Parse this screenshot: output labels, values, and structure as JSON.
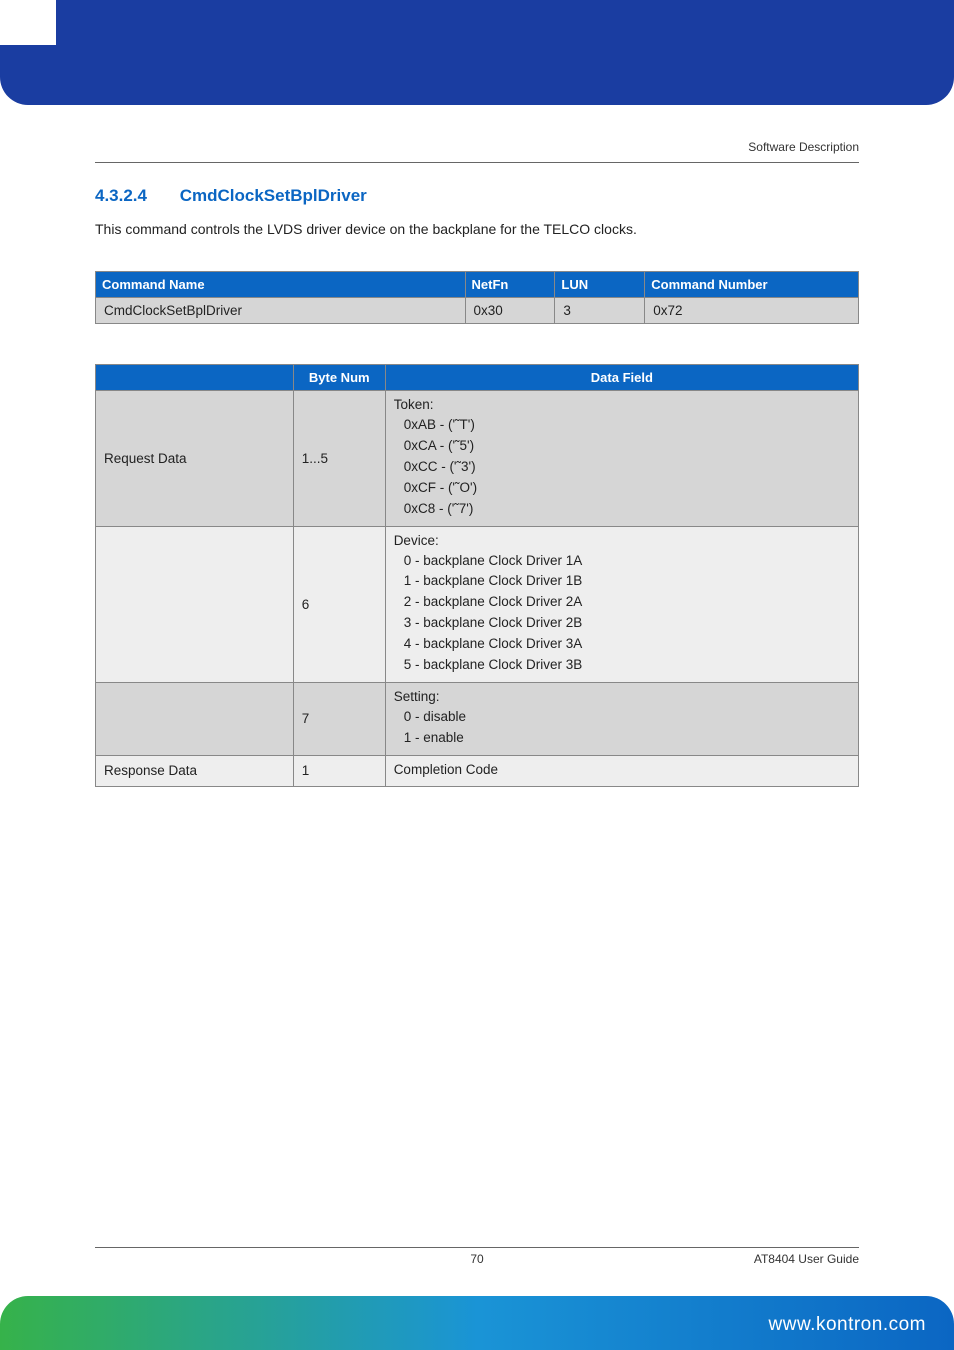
{
  "header": {
    "chapter": "Software Description"
  },
  "section": {
    "number": "4.3.2.4",
    "title": "CmdClockSetBplDriver"
  },
  "paragraph": "This command controls the LVDS driver device on the backplane for the TELCO clocks.",
  "table1": {
    "headers": {
      "name": "Command Name",
      "netfn": "NetFn",
      "lun": "LUN",
      "cmd": "Command Number"
    },
    "row": {
      "name": "CmdClockSetBplDriver",
      "netfn": "0x30",
      "lun": "3",
      "cmd": "0x72"
    }
  },
  "table2": {
    "headers": {
      "col1": "",
      "col2": "Byte Num",
      "col3": "Data Field"
    },
    "rows": [
      {
        "label": "Request Data",
        "byte": "1...5",
        "data": {
          "heading": "Token:",
          "items": [
            "0xAB - ('˜T')",
            "0xCA - ('˜5')",
            "0xCC - ('˜3')",
            "0xCF - ('˜O')",
            "0xC8 - ('˜7')"
          ]
        }
      },
      {
        "label": "",
        "byte": "6",
        "data": {
          "heading": "Device:",
          "items": [
            "0 - backplane Clock Driver 1A",
            "1 - backplane Clock Driver 1B",
            "2 - backplane Clock Driver 2A",
            "3 - backplane Clock Driver 2B",
            "4 - backplane Clock Driver 3A",
            "5 - backplane Clock Driver 3B"
          ]
        }
      },
      {
        "label": "",
        "byte": "7",
        "data": {
          "heading": "Setting:",
          "items": [
            "0 - disable",
            "1 - enable"
          ]
        }
      },
      {
        "label": "Response Data",
        "byte": "1",
        "data": {
          "heading": "Completion Code",
          "items": []
        }
      }
    ]
  },
  "footer": {
    "page": "70",
    "guide": "AT8404 User  Guide",
    "url": "www.kontron.com"
  }
}
